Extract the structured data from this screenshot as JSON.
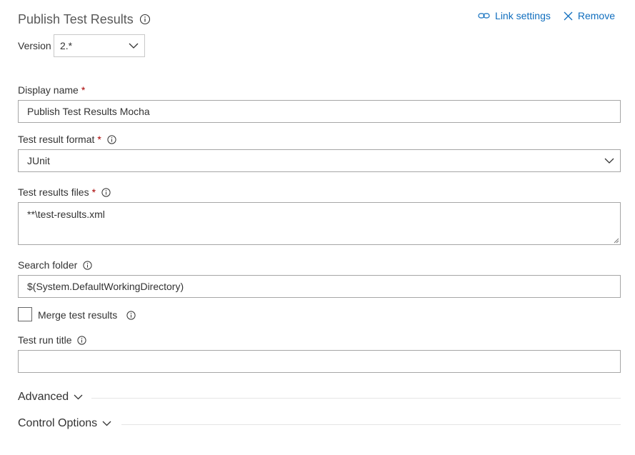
{
  "header": {
    "title": "Publish Test Results",
    "link_settings": "Link settings",
    "remove": "Remove",
    "accent_color": "#106ebe"
  },
  "version": {
    "label": "Version",
    "value": "2.*"
  },
  "fields": {
    "display_name": {
      "label": "Display name",
      "required": "*",
      "value": "Publish Test Results Mocha"
    },
    "test_result_format": {
      "label": "Test result format",
      "required": "*",
      "value": "JUnit"
    },
    "test_results_files": {
      "label": "Test results files",
      "required": "*",
      "value": "**\\test-results.xml"
    },
    "search_folder": {
      "label": "Search folder",
      "value": "$(System.DefaultWorkingDirectory)"
    },
    "merge_test_results": {
      "label": "Merge test results",
      "checked": false
    },
    "test_run_title": {
      "label": "Test run title",
      "value": ""
    }
  },
  "sections": {
    "advanced": "Advanced",
    "control_options": "Control Options"
  },
  "icons": [
    "info-icon",
    "link-icon",
    "close-icon",
    "chevron-down-icon"
  ]
}
